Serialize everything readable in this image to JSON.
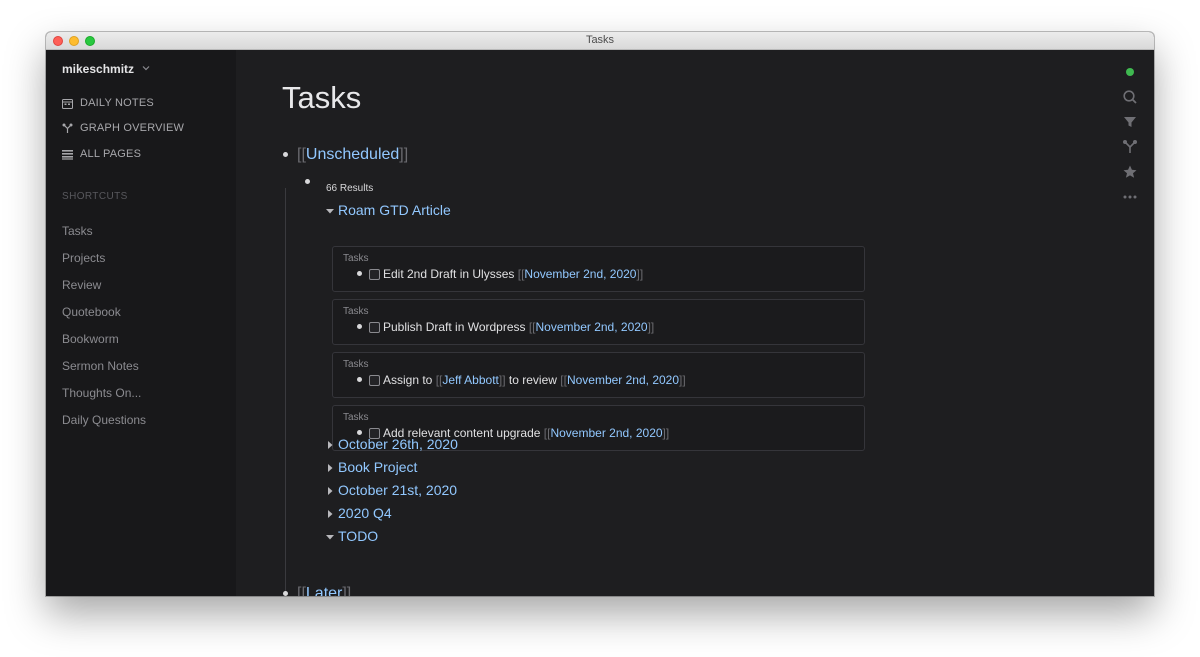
{
  "window": {
    "title": "Tasks"
  },
  "sidebar": {
    "user": "mikeschmitz",
    "nav": [
      {
        "label": "DAILY NOTES",
        "icon": "calendar-icon"
      },
      {
        "label": "GRAPH OVERVIEW",
        "icon": "graph-icon"
      },
      {
        "label": "ALL PAGES",
        "icon": "list-icon"
      }
    ],
    "section_label": "SHORTCUTS",
    "shortcuts": [
      "Tasks",
      "Projects",
      "Review",
      "Quotebook",
      "Bookworm",
      "Sermon Notes",
      "Thoughts On...",
      "Daily Questions"
    ]
  },
  "page": {
    "title": "Tasks",
    "ref_unscheduled": {
      "open": "[[",
      "label": "Unscheduled",
      "close": "]]"
    },
    "results": "66 Results",
    "expanded_group": "Roam GTD Article",
    "cards": [
      {
        "title": "Tasks",
        "text": "Edit 2nd Draft in Ulysses",
        "date": "November 2nd, 2020"
      },
      {
        "title": "Tasks",
        "text": "Publish Draft in Wordpress",
        "date": "November 2nd, 2020"
      },
      {
        "title": "Tasks",
        "text_before": "Assign to",
        "person": "Jeff Abbott",
        "text_after": "to review",
        "date": "November 2nd, 2020"
      },
      {
        "title": "Tasks",
        "text": "Add relevant content upgrade",
        "date": "November 2nd, 2020"
      }
    ],
    "collapsed_groups": [
      "October 26th, 2020",
      "Book Project",
      "October 21st, 2020",
      "2020 Q4"
    ],
    "todo_group": "TODO",
    "ref_later": {
      "open": "[[",
      "label": "Later",
      "close": "]]"
    },
    "bracket_open": "[[",
    "bracket_close": "]]"
  },
  "right_rail": [
    "sync-status-icon",
    "search-icon",
    "filter-icon",
    "graph-icon",
    "star-icon",
    "more-icon"
  ],
  "colors": {
    "link": "#92c8ff",
    "background": "#1e1e20",
    "sidebar": "#18181a",
    "status": "#3fb950"
  }
}
